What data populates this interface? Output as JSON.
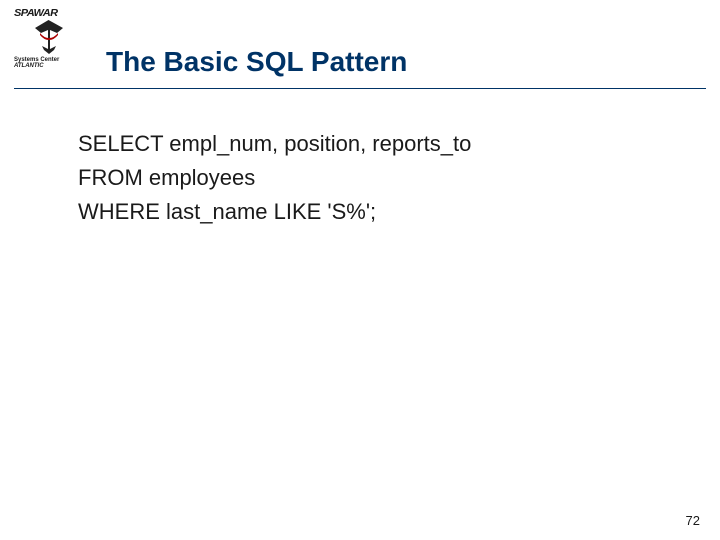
{
  "logo": {
    "brand": "SPAWAR",
    "line1": "Systems Center",
    "line2": "ATLANTIC"
  },
  "title": "The Basic SQL Pattern",
  "sql": {
    "line1": "SELECT empl_num, position, reports_to",
    "line2": "FROM employees",
    "line3": "WHERE last_name LIKE 'S%';"
  },
  "page_number": "72"
}
